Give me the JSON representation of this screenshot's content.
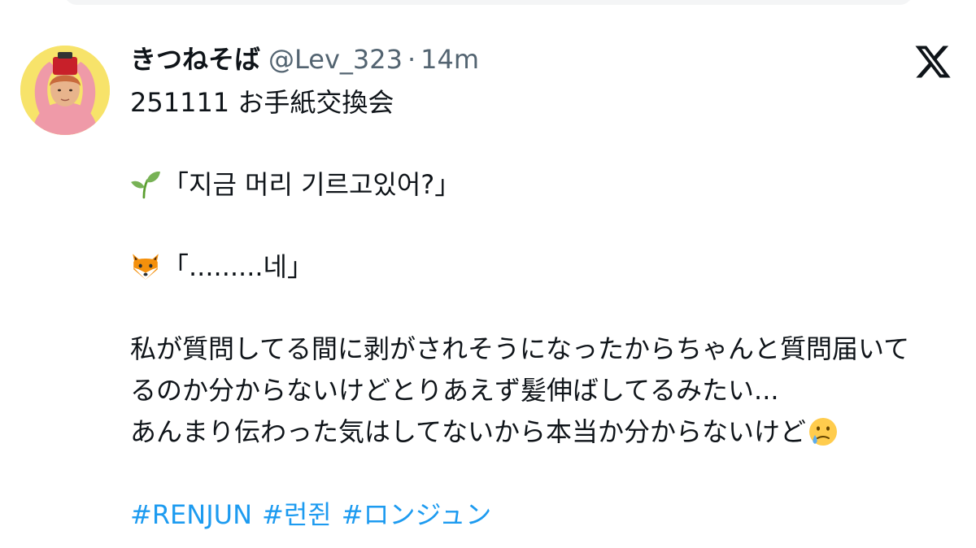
{
  "post": {
    "author": {
      "display_name": "きつねそば",
      "handle": "@Lev_323"
    },
    "separator": "·",
    "time": "14m",
    "lines": [
      "251111 お手紙交換会",
      "「지금 머리 기르고있어?」",
      "「.........네」",
      "私が質問してる間に剥がされそうになったからちゃんと質問届いて",
      "るのか分からないけどとりあえず髪伸ばしてるみたい...",
      "あんまり伝わった気はしてないから本当か分からないけど"
    ],
    "hashtags": [
      "#RENJUN",
      "#런쥔",
      "#ロンジュン"
    ]
  },
  "icons": {
    "avatar": "profile-photo",
    "logo": "x-logo-icon",
    "seedling": "seedling-emoji-icon",
    "fox": "fox-emoji-icon",
    "tear": "face-holding-back-tears-emoji-icon"
  },
  "colors": {
    "text": "#0f1419",
    "secondary": "#536471",
    "hashtag": "#1d9bf0",
    "avatar_bg": "#f7e36a"
  }
}
